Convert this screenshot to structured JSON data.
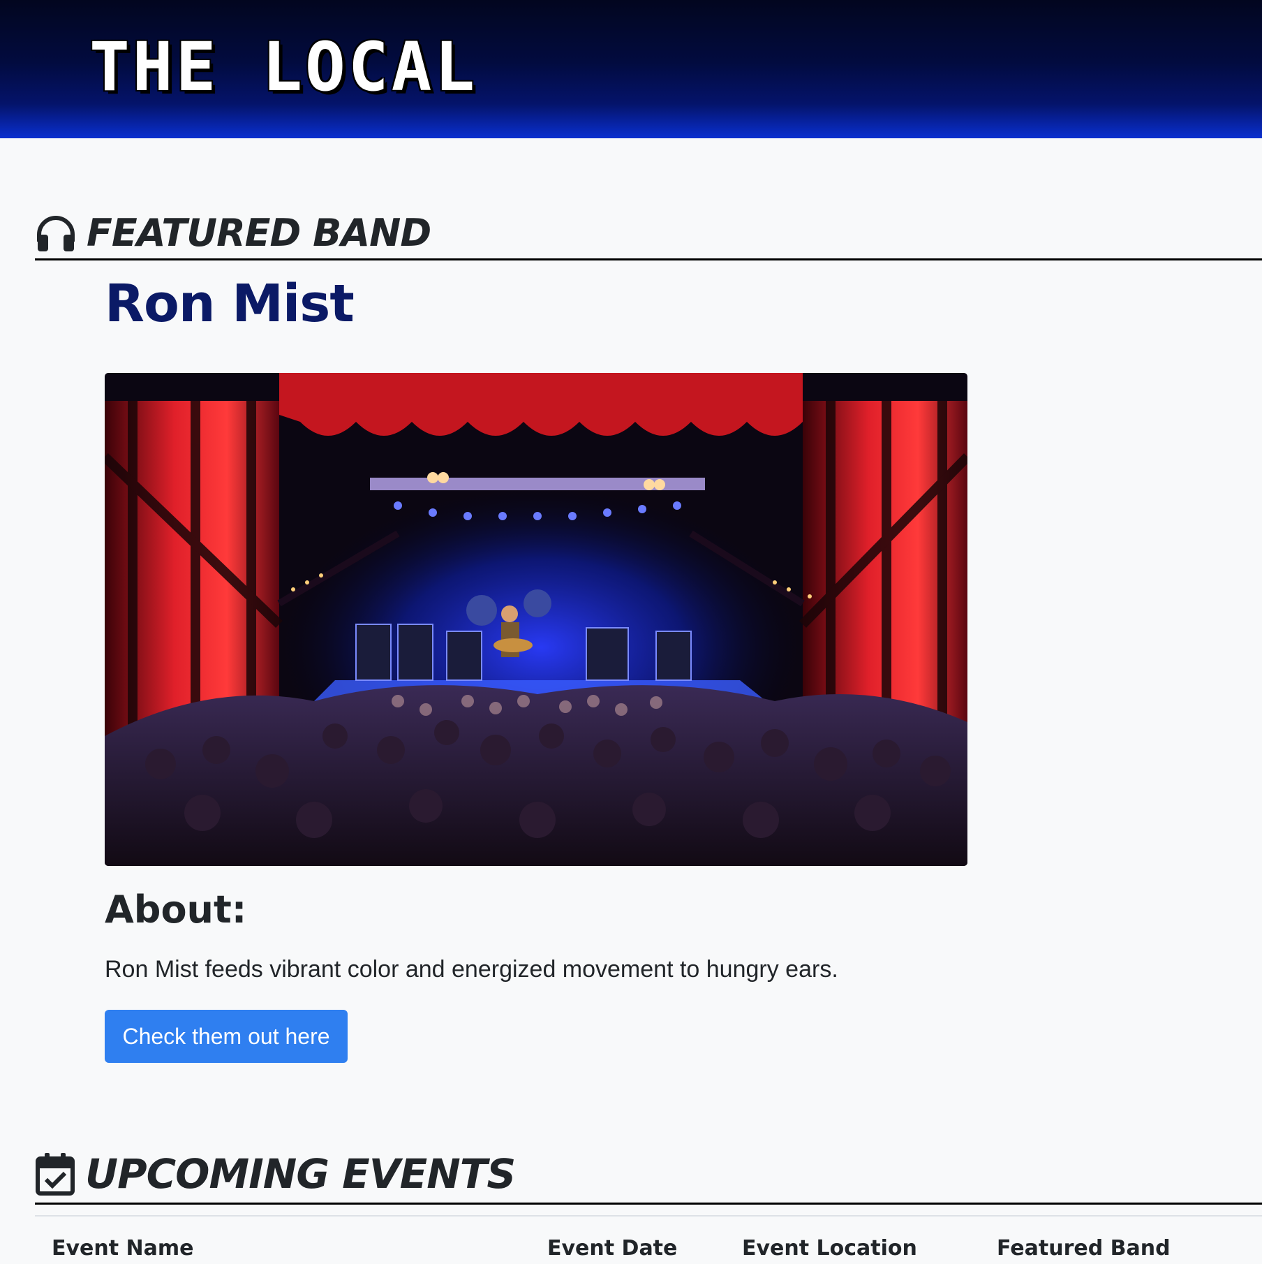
{
  "header": {
    "logo_text": "THE LOCAL"
  },
  "featured": {
    "section_title": "FEATURED BAND",
    "section_icon": "headphones-icon",
    "band_name": "Ron Mist",
    "photo_subject": "concert-stage-photo",
    "about_heading": "About:",
    "about_text": "Ron Mist feeds vibrant color and energized movement to hungry ears.",
    "cta_label": "Check them out here"
  },
  "events": {
    "section_title": "UPCOMING EVENTS",
    "section_icon": "calendar-check-icon",
    "columns": [
      "Event Name",
      "Event Date",
      "Event Location",
      "Featured Band"
    ]
  },
  "colors": {
    "header_dark": "#02061f",
    "header_blue": "#0a2fcf",
    "band_name": "#0b1a66",
    "button": "#2f7ff0",
    "page_bg": "#f8f9fa"
  }
}
